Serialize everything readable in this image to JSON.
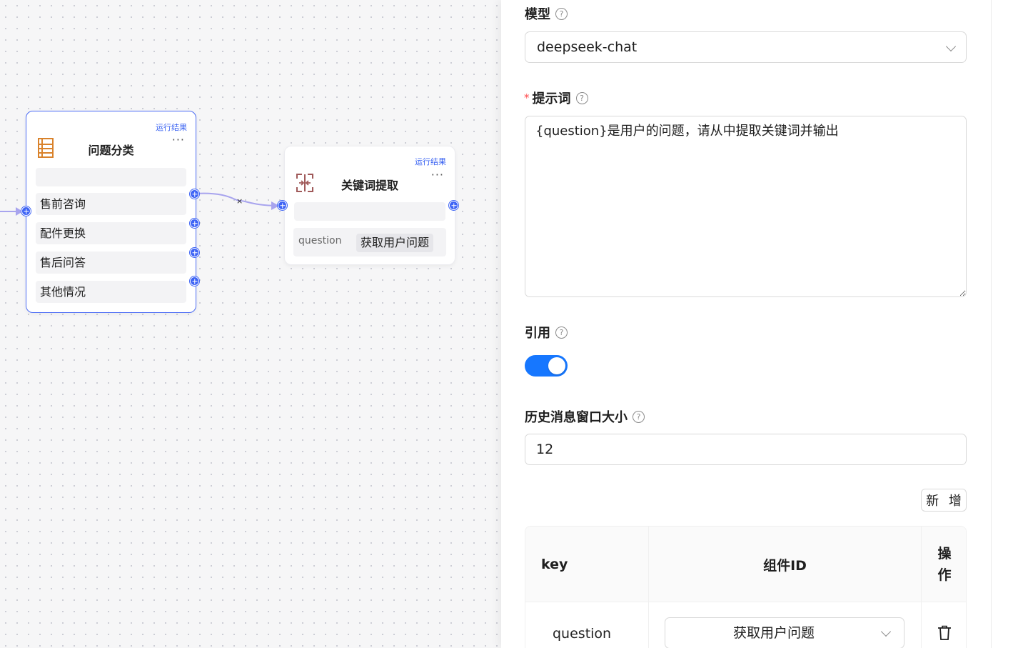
{
  "canvas": {
    "nodes": {
      "classify": {
        "run_result": "运行结果",
        "title": "问题分类",
        "more": "···",
        "categories": [
          "售前咨询",
          "配件更换",
          "售后问答",
          "其他情况"
        ]
      },
      "keyword": {
        "run_result": "运行结果",
        "title": "关键词提取",
        "more": "···",
        "param_key": "question",
        "param_value": "获取用户问题"
      }
    },
    "edge_delete": "×"
  },
  "panel": {
    "model": {
      "label": "模型",
      "value": "deepseek-chat"
    },
    "prompt": {
      "label": "提示词",
      "required_mark": "*",
      "value": "{question}是用户的问题，请从中提取关键词并输出"
    },
    "cite": {
      "label": "引用",
      "enabled": true
    },
    "history": {
      "label": "历史消息窗口大小",
      "value": "12"
    },
    "add_button": "新 增",
    "table": {
      "headers": {
        "key": "key",
        "component": "组件ID",
        "op": "操作"
      },
      "rows": [
        {
          "key": "question",
          "component": "获取用户问题"
        }
      ]
    },
    "help_glyph": "?"
  },
  "colors": {
    "accent": "#1677ff",
    "handle": "#3d63f5",
    "selected_border": "#4c6cf5",
    "classify_icon": "#d9822b",
    "keyword_icon": "#a05a5a",
    "required": "#ff4d4f"
  }
}
